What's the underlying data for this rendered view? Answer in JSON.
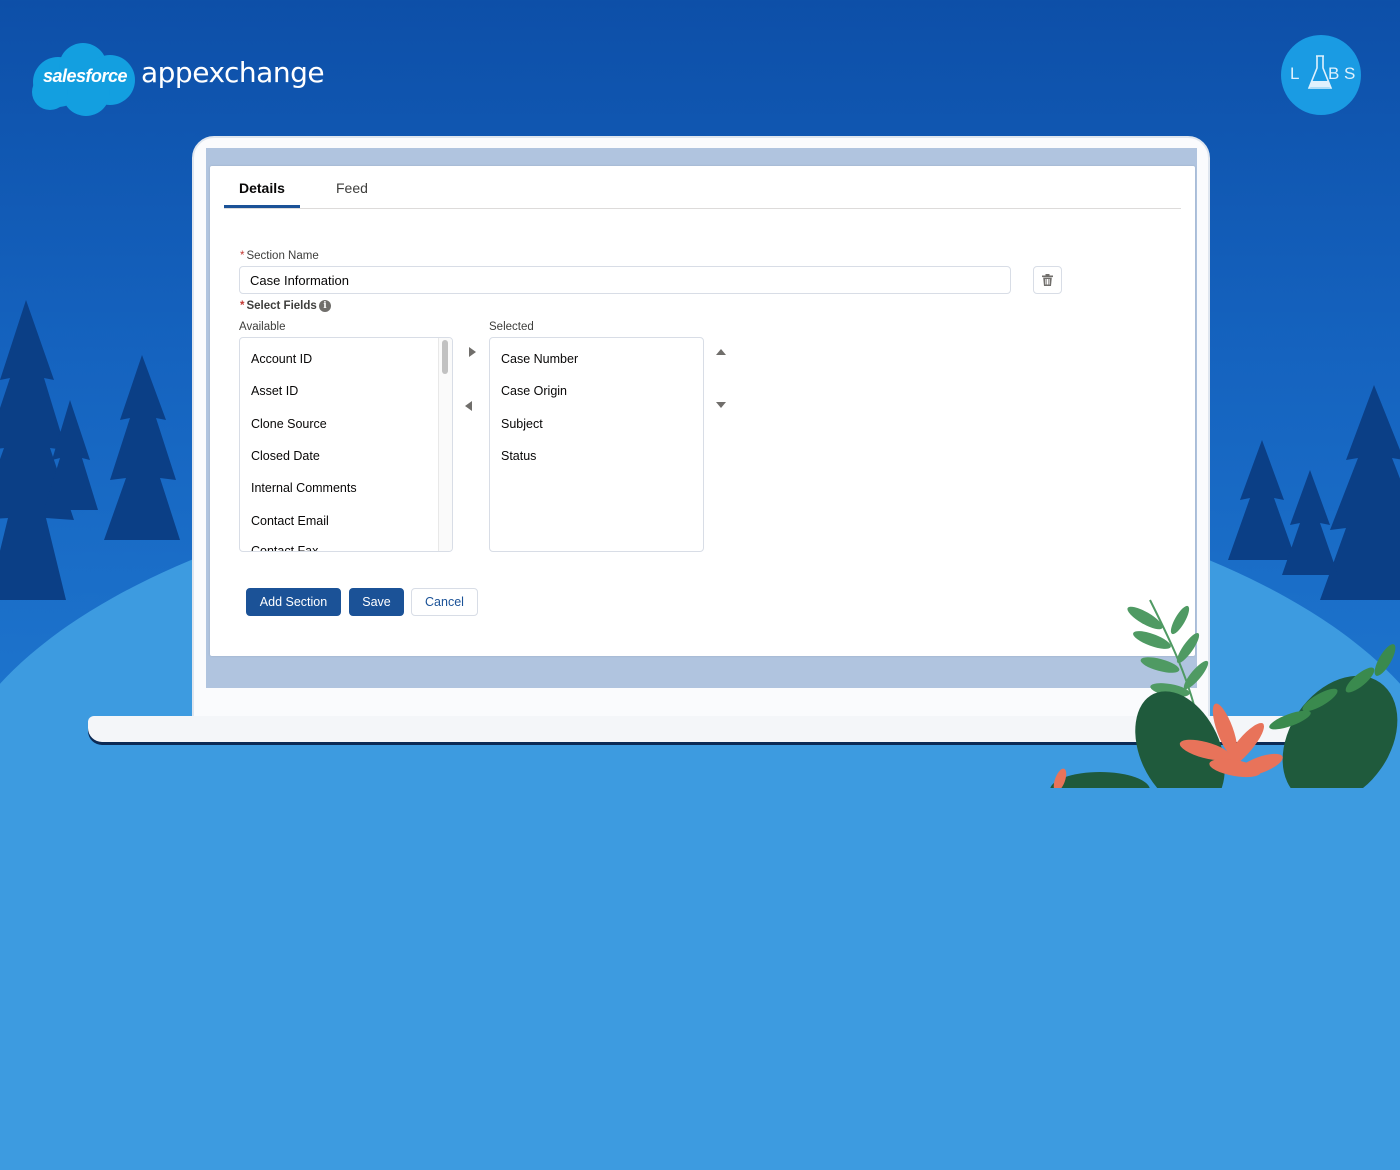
{
  "brand": {
    "salesforce": "salesforce",
    "appexchange": "appexchange",
    "labs_letters": [
      "L",
      "B",
      "S"
    ]
  },
  "tabs": [
    {
      "label": "Details",
      "active": true
    },
    {
      "label": "Feed",
      "active": false
    }
  ],
  "form": {
    "section_name_label": "Section Name",
    "section_name_value": "Case Information",
    "select_fields_label": "Select Fields",
    "info_glyph": "i",
    "required_mark": "*",
    "available_label": "Available",
    "selected_label": "Selected",
    "available_items": [
      "Account ID",
      "Asset ID",
      "Clone Source",
      "Closed Date",
      "Internal Comments",
      "Contact Email",
      "Contact Fax"
    ],
    "selected_items": [
      "Case Number",
      "Case Origin",
      "Subject",
      "Status"
    ]
  },
  "buttons": {
    "add_section": "Add Section",
    "save": "Save",
    "cancel": "Cancel"
  },
  "colors": {
    "brand_button": "#1b5297",
    "background_blue": "#1563bf",
    "required": "#c23934"
  }
}
